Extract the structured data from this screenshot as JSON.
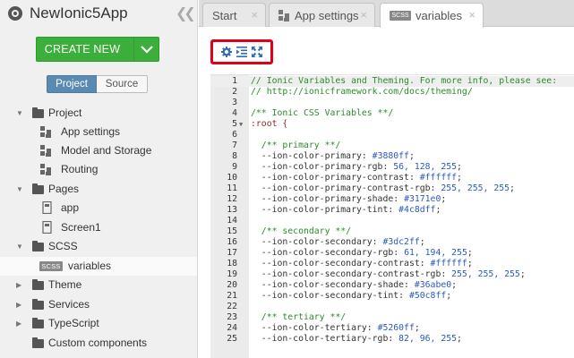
{
  "app": {
    "title": "NewIonic5App",
    "collapse_glyph": "《"
  },
  "create_new": {
    "label": "CREATE NEW"
  },
  "view_toggle": {
    "project_label": "Project",
    "source_label": "Source"
  },
  "tree": [
    {
      "label": "Project",
      "kind": "folder",
      "arrow": "▼"
    },
    {
      "label": "App settings",
      "kind": "grid"
    },
    {
      "label": "Model and Storage",
      "kind": "grid"
    },
    {
      "label": "Routing",
      "kind": "grid"
    },
    {
      "label": "Pages",
      "kind": "folder",
      "arrow": "▼"
    },
    {
      "label": "app",
      "kind": "page"
    },
    {
      "label": "Screen1",
      "kind": "page"
    },
    {
      "label": "SCSS",
      "kind": "folder",
      "arrow": "▼"
    },
    {
      "label": "variables",
      "kind": "scss",
      "badge": "SCSS",
      "selected": true
    },
    {
      "label": "Theme",
      "kind": "folder",
      "arrow": "▶"
    },
    {
      "label": "Services",
      "kind": "folder",
      "arrow": "▶"
    },
    {
      "label": "TypeScript",
      "kind": "folder",
      "arrow": "▶"
    },
    {
      "label": "Custom components",
      "kind": "folder",
      "arrow": ""
    }
  ],
  "tabs": [
    {
      "label": "Start",
      "close": "×"
    },
    {
      "label": "App settings",
      "close": "×"
    },
    {
      "label": "variables",
      "badge": "SCSS",
      "close": "×",
      "active": true
    }
  ],
  "toolbar": {
    "icons": [
      "gear-icon",
      "indent-icon",
      "expand-icon"
    ]
  },
  "code": [
    {
      "n": "1",
      "text": "// Ionic Variables and Theming. For more info, please see:",
      "kind": "comment",
      "active": true
    },
    {
      "n": "2",
      "text": "// http://ionicframework.com/docs/theming/",
      "kind": "comment"
    },
    {
      "n": "3",
      "text": "",
      "kind": "plain"
    },
    {
      "n": "4",
      "text": "/** Ionic CSS Variables **/",
      "kind": "comment"
    },
    {
      "n": "5",
      "text": ":root {",
      "kind": "selector",
      "fold": "▼"
    },
    {
      "n": "6",
      "text": "",
      "kind": "plain"
    },
    {
      "n": "7",
      "text": "  /** primary **/",
      "kind": "comment"
    },
    {
      "n": "8",
      "prop": "  --ion-color-primary: ",
      "val": "#3880ff",
      "end": ";"
    },
    {
      "n": "9",
      "prop": "  --ion-color-primary-rgb: ",
      "val": "56, 128, 255",
      "end": ";"
    },
    {
      "n": "10",
      "prop": "  --ion-color-primary-contrast: ",
      "val": "#ffffff",
      "end": ";"
    },
    {
      "n": "11",
      "prop": "  --ion-color-primary-contrast-rgb: ",
      "val": "255, 255, 255",
      "end": ";"
    },
    {
      "n": "12",
      "prop": "  --ion-color-primary-shade: ",
      "val": "#3171e0",
      "end": ";"
    },
    {
      "n": "13",
      "prop": "  --ion-color-primary-tint: ",
      "val": "#4c8dff",
      "end": ";"
    },
    {
      "n": "14",
      "text": "",
      "kind": "plain"
    },
    {
      "n": "15",
      "text": "  /** secondary **/",
      "kind": "comment"
    },
    {
      "n": "16",
      "prop": "  --ion-color-secondary: ",
      "val": "#3dc2ff",
      "end": ";"
    },
    {
      "n": "17",
      "prop": "  --ion-color-secondary-rgb: ",
      "val": "61, 194, 255",
      "end": ";"
    },
    {
      "n": "18",
      "prop": "  --ion-color-secondary-contrast: ",
      "val": "#ffffff",
      "end": ";"
    },
    {
      "n": "19",
      "prop": "  --ion-color-secondary-contrast-rgb: ",
      "val": "255, 255, 255",
      "end": ";"
    },
    {
      "n": "20",
      "prop": "  --ion-color-secondary-shade: ",
      "val": "#36abe0",
      "end": ";"
    },
    {
      "n": "21",
      "prop": "  --ion-color-secondary-tint: ",
      "val": "#50c8ff",
      "end": ";"
    },
    {
      "n": "22",
      "text": "",
      "kind": "plain"
    },
    {
      "n": "23",
      "text": "  /** tertiary **/",
      "kind": "comment"
    },
    {
      "n": "24",
      "prop": "  --ion-color-tertiary: ",
      "val": "#5260ff",
      "end": ";"
    },
    {
      "n": "25",
      "prop": "  --ion-color-tertiary-rgb: ",
      "val": "82, 96, 255",
      "end": ";"
    }
  ],
  "colors": {
    "create_green": "#3cae3c",
    "toggle_blue": "#5a8ab0",
    "highlight_red": "#e0001a",
    "comment_green": "#2a8c2a",
    "value_blue": "#2a5ac0",
    "selector_red": "#8b2c2c"
  }
}
